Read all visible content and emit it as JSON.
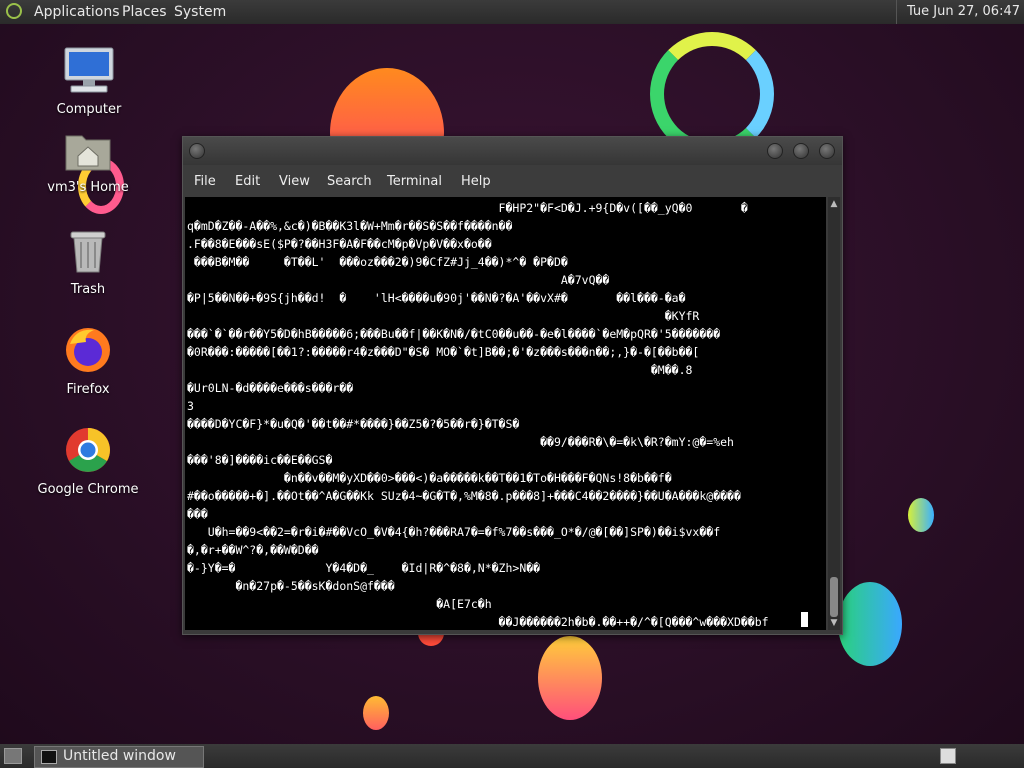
{
  "top_panel": {
    "menus": [
      "Applications",
      "Places",
      "System"
    ],
    "clock": "Tue Jun 27, 06:47"
  },
  "desktop_icons": [
    {
      "label": "Computer",
      "icon": "computer-icon"
    },
    {
      "label": "vm3's Home",
      "icon": "home-folder-icon"
    },
    {
      "label": "Trash",
      "icon": "trash-icon"
    },
    {
      "label": "Firefox",
      "icon": "firefox-icon"
    },
    {
      "label": "Google Chrome",
      "icon": "chrome-icon"
    }
  ],
  "terminal": {
    "menus": [
      "File",
      "Edit",
      "View",
      "Search",
      "Terminal",
      "Help"
    ],
    "lines": [
      "                                             F�HP2\"�F<D�J.+9{D�v([��_yQ�0       �",
      "q�mD�Z��-A��%,&c�)�B��K3l�W+Mm�r��S�S��f����n��",
      ".F��8�E���sE($P�?��H3F�A�F��cM�p�Vp�V��x�o��",
      " ���B�M��     �T��L'  ���oz���2�)9�CfZ#Jj_4��)*^� �P�D�",
      "                                                      A�7vQ��",
      "�P|5��N��+�9S{jh��d!  �    'lH<����u�90j'��N�?�A'��vX#�       ��l���-�a�",
      "                                                                     �KYfR",
      "���`�`��r��Y5�D�hB�����6;���Bu��f|��K�N�/�tC0��u��-�e�l����`�eM�pQR�'5�������",
      "�0R���:�����[��1?:�����r4�z���D\"�S� MO�`�t]B��;�'�z���s���n��;,}�-�[��b��[",
      "                                                                   �M��.8",
      "�Ur0LN-�d����e���s���r��",
      "3",
      "����D�YC�F}*�u�Q�'��t��#*����}��Z5�?�5��r�}�T�S�",
      "                                                   ��9/���R�\\�=�k\\�R?�mY:@�=%eh",
      "���'8�]����ic��E��GS�",
      "              �n��v��M�yXD��0>���<)�a�����k��T��1�To�H���F�QNs!8�b��f�",
      "#��o�����+�].��Ot��^A�G��Kk SUz�4~�G�T�,%M�8�.p���8]+���C4��2����}��U�A���k@����",
      "���",
      "   U�h=��9<��2=�r�i�#��VcO_�V�4{�h?���RA7�=�f%7��s���_O*�/@�[��]SP�)��i$vx��f",
      "�,�r+��W^?�,��W�D��",
      "�-}Y�=�             Y�4�D�_    �Id|R�^�8�,N*�Zh>N��",
      "       �n�27p�-5��sK�donS@f���",
      "                                    �A[E7c�h",
      "                                             ��J������2h�b�.��++�/^�[Q���^w���XD��bf"
    ]
  },
  "bottom_panel": {
    "task_label": "Untitled window"
  },
  "colors": {
    "wallpaper": "#2b0f27",
    "terminal_bg": "#000000",
    "panel": "#333333"
  }
}
